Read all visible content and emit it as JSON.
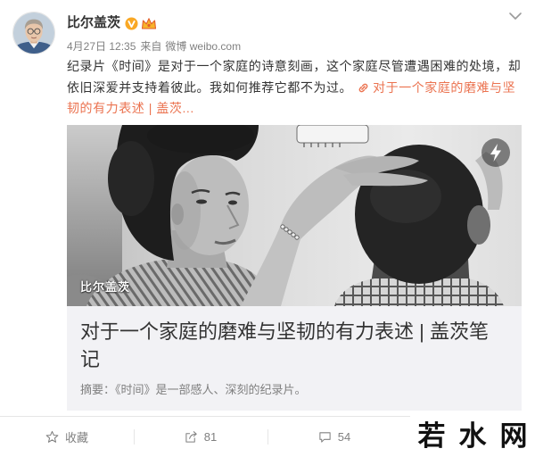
{
  "post": {
    "author": {
      "name": "比尔盖茨",
      "avatar_icon": "bill-gates-avatar",
      "verified_icon": "verified-v-icon",
      "vip_icon": "crown-icon"
    },
    "menu_icon": "chevron-down-icon",
    "meta": {
      "time": "4月27日 12:35",
      "source_prefix": "来自",
      "source": "微博 weibo.com"
    },
    "text": "纪录片《时间》是对于一个家庭的诗意刻画，这个家庭尽管遭遇困难的处境，却依旧深爱并支持着彼此。我如何推荐它都不为过。",
    "link": {
      "icon": "link-icon",
      "text": "对于一个家庭的磨难与坚韧的有力表述 | 盖茨..."
    }
  },
  "card": {
    "image_watermark": "比尔盖茨",
    "badge_icon": "lightning-icon",
    "title": "对于一个家庭的磨难与坚韧的有力表述 | 盖茨笔记",
    "summary": "摘要：《时间》是一部感人、深刻的纪录片。"
  },
  "actions": [
    {
      "icon": "star-icon",
      "label": "收藏"
    },
    {
      "icon": "forward-icon",
      "label": "81"
    },
    {
      "icon": "comment-icon",
      "label": "54"
    }
  ],
  "site_watermark": "若水网",
  "colors": {
    "text": "#333333",
    "muted": "#808080",
    "link": "#eb7350",
    "card_bg": "#f2f2f5",
    "verified_badge": "#f9a825"
  }
}
